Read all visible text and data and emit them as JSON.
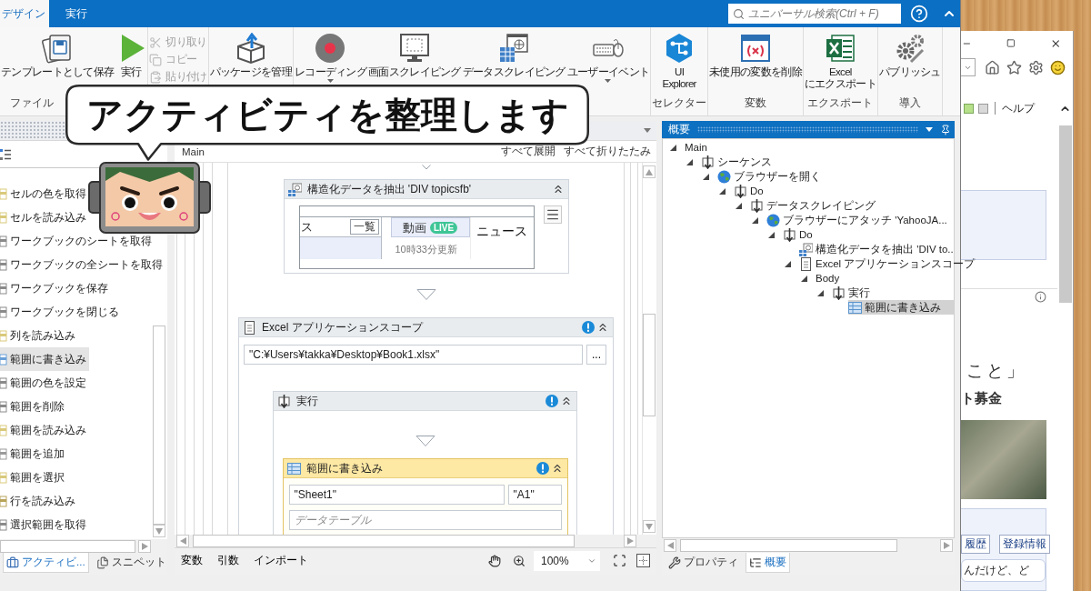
{
  "app": {
    "tabs": [
      {
        "label": "デザイン",
        "selected": true
      },
      {
        "label": "実行",
        "selected": false
      }
    ],
    "search": {
      "placeholder": "ユニバーサル検索(Ctrl + F)"
    }
  },
  "ribbon": {
    "groups": [
      {
        "label": "ファイル",
        "items": [
          {
            "kind": "large",
            "label": "テンプレートとして保存",
            "disabled": false,
            "dropdown": false
          },
          {
            "kind": "large",
            "label": "実行",
            "disabled": false,
            "dropdown": false
          }
        ]
      },
      {
        "items": [
          {
            "kind": "small",
            "label": "切り取り",
            "disabled": true,
            "dropdown": false
          },
          {
            "kind": "small",
            "label": "コピー",
            "disabled": true,
            "dropdown": false
          },
          {
            "kind": "small",
            "label": "貼り付け",
            "disabled": true,
            "dropdown": false
          }
        ]
      },
      {
        "items": [
          {
            "kind": "large",
            "label": "パッケージを管理",
            "disabled": false,
            "dropdown": false
          }
        ]
      },
      {
        "items": [
          {
            "kind": "large",
            "label": "レコーディング",
            "disabled": false,
            "dropdown": true
          },
          {
            "kind": "large",
            "label": "画面スクレイピング",
            "disabled": false,
            "dropdown": false
          },
          {
            "kind": "large",
            "label": "データスクレイピング",
            "disabled": false,
            "dropdown": false
          },
          {
            "kind": "large",
            "label": "ユーザーイベント",
            "disabled": false,
            "dropdown": true
          }
        ]
      },
      {
        "label": "セレクター",
        "items": [
          {
            "kind": "large",
            "label": "UI\nExplorer",
            "disabled": false,
            "dropdown": false
          }
        ]
      },
      {
        "label": "変数",
        "items": [
          {
            "kind": "large",
            "label": "未使用の変数を削除",
            "disabled": false,
            "dropdown": false
          }
        ]
      },
      {
        "label": "エクスポート",
        "items": [
          {
            "kind": "large",
            "label": "Excel\nにエクスポート",
            "disabled": false,
            "dropdown": false
          }
        ]
      },
      {
        "label": "導入",
        "items": [
          {
            "kind": "large",
            "label": "パブリッシュ",
            "disabled": false,
            "dropdown": false
          }
        ]
      }
    ]
  },
  "callout": {
    "text": "アクティビティを整理します"
  },
  "activities": {
    "items": [
      {
        "label": "セルの色を取得",
        "selected": false
      },
      {
        "label": "セルを読み込み",
        "selected": false
      },
      {
        "label": "ワークブックのシートを取得",
        "selected": false
      },
      {
        "label": "ワークブックの全シートを取得",
        "selected": false
      },
      {
        "label": "ワークブックを保存",
        "selected": false
      },
      {
        "label": "ワークブックを閉じる",
        "selected": false
      },
      {
        "label": "列を読み込み",
        "selected": false
      },
      {
        "label": "範囲に書き込み",
        "selected": true
      },
      {
        "label": "範囲の色を設定",
        "selected": false
      },
      {
        "label": "範囲を削除",
        "selected": false
      },
      {
        "label": "範囲を読み込み",
        "selected": false
      },
      {
        "label": "範囲を追加",
        "selected": false
      },
      {
        "label": "範囲を選択",
        "selected": false
      },
      {
        "label": "行を読み込み",
        "selected": false
      },
      {
        "label": "選択範囲を取得",
        "selected": false
      }
    ],
    "tabs": [
      {
        "label": "アクティビ...",
        "selected": true
      },
      {
        "label": "スニペット",
        "selected": false
      }
    ]
  },
  "designer": {
    "breadcrumb": "Main",
    "expand_all": "すべて展開",
    "collapse_all": "すべて折りたたみ",
    "activities": [
      {
        "kind": "extract",
        "title": "構造化データを抽出 'DIV topicsfb'",
        "warning": false,
        "selected": false,
        "preview": {
          "tab": "ス",
          "list_button": "一覧",
          "video_tab": "動画",
          "live_badge": "LIVE",
          "updated": "10時33分更新",
          "news": "ニュース"
        }
      },
      {
        "kind": "scope",
        "title": "Excel アプリケーションスコープ",
        "warning": true,
        "selected": false,
        "path": "\"C:¥Users¥takka¥Desktop¥Book1.xlsx\"",
        "browse_button": "...",
        "children": [
          {
            "kind": "sequence",
            "title": "実行",
            "warning": true,
            "selected": false,
            "children": [
              {
                "kind": "write_range",
                "title": "範囲に書き込み",
                "warning": true,
                "selected": true,
                "sheet": "\"Sheet1\"",
                "cell": "\"A1\"",
                "placeholder": "データテーブル"
              }
            ]
          }
        ]
      }
    ],
    "bottom": {
      "tabs": [
        "変数",
        "引数",
        "インポート"
      ],
      "zoom": "100%"
    }
  },
  "outline": {
    "title": "概要",
    "tree": [
      {
        "kind": "root",
        "label": "Main",
        "expanded": true,
        "selected": false,
        "children": [
          {
            "kind": "sequence",
            "label": "シーケンス",
            "expanded": true,
            "selected": false,
            "children": [
              {
                "kind": "browser",
                "label": "ブラウザーを開く",
                "expanded": true,
                "selected": false,
                "children": [
                  {
                    "kind": "sequence",
                    "label": "Do",
                    "expanded": true,
                    "selected": false,
                    "children": [
                      {
                        "kind": "sequence",
                        "label": "データスクレイピング",
                        "expanded": true,
                        "selected": false,
                        "children": [
                          {
                            "kind": "browser",
                            "label": "ブラウザーにアタッチ 'YahooJA...",
                            "expanded": true,
                            "selected": false,
                            "children": [
                              {
                                "kind": "sequence",
                                "label": "Do",
                                "expanded": true,
                                "selected": false,
                                "children": [
                                  {
                                    "kind": "extract",
                                    "label": "構造化データを抽出 'DIV to..",
                                    "expanded": false,
                                    "selected": false
                                  },
                                  {
                                    "kind": "scope",
                                    "label": "Excel アプリケーションスコープ",
                                    "expanded": true,
                                    "selected": false,
                                    "children": [
                                      {
                                        "kind": "body",
                                        "label": "Body",
                                        "expanded": true,
                                        "selected": false,
                                        "children": [
                                          {
                                            "kind": "sequence",
                                            "label": "実行",
                                            "expanded": true,
                                            "selected": false,
                                            "children": [
                                              {
                                                "kind": "write_range",
                                                "label": "範囲に書き込み",
                                                "expanded": false,
                                                "selected": true
                                              }
                                            ]
                                          }
                                        ]
                                      }
                                    ]
                                  }
                                ]
                              }
                            ]
                          }
                        ]
                      }
                    ]
                  }
                ]
              }
            ]
          }
        ]
      }
    ],
    "tabs": [
      {
        "label": "プロパティ",
        "selected": false
      },
      {
        "label": "概要",
        "selected": true
      }
    ]
  },
  "browser": {
    "menu": "ヘルプ",
    "headline": "こと」",
    "campaign": "ト募金",
    "buttons": [
      "履歴",
      "登録情報"
    ],
    "comment": "んだけど、ど"
  }
}
